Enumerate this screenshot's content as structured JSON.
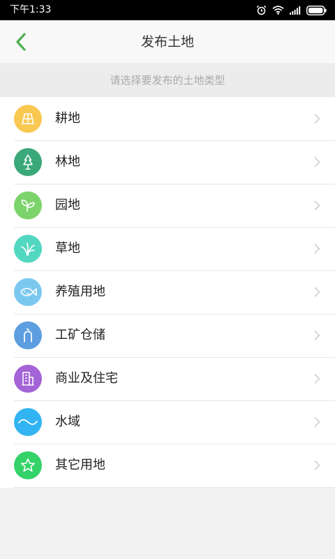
{
  "status_bar": {
    "time": "下午1:33",
    "icons": [
      "alarm-icon",
      "wifi-icon",
      "signal-icon",
      "battery-icon"
    ]
  },
  "header": {
    "title": "发布土地",
    "back_icon": "chevron-left-icon",
    "accent_color": "#4caf50"
  },
  "prompt": "请选择要发布的土地类型",
  "land_types": [
    {
      "label": "耕地",
      "icon": "farmland-icon",
      "color": "#f9c851"
    },
    {
      "label": "林地",
      "icon": "tree-icon",
      "color": "#3aa878"
    },
    {
      "label": "园地",
      "icon": "sprout-icon",
      "color": "#7dd36b"
    },
    {
      "label": "草地",
      "icon": "grass-icon",
      "color": "#52d7c0"
    },
    {
      "label": "养殖用地",
      "icon": "fish-icon",
      "color": "#7bc8ef"
    },
    {
      "label": "工矿仓储",
      "icon": "mine-icon",
      "color": "#5c9ee0"
    },
    {
      "label": "商业及住宅",
      "icon": "building-icon",
      "color": "#a463d6"
    },
    {
      "label": "水域",
      "icon": "water-icon",
      "color": "#33b4f2"
    },
    {
      "label": "其它用地",
      "icon": "star-icon",
      "color": "#35d269"
    }
  ]
}
